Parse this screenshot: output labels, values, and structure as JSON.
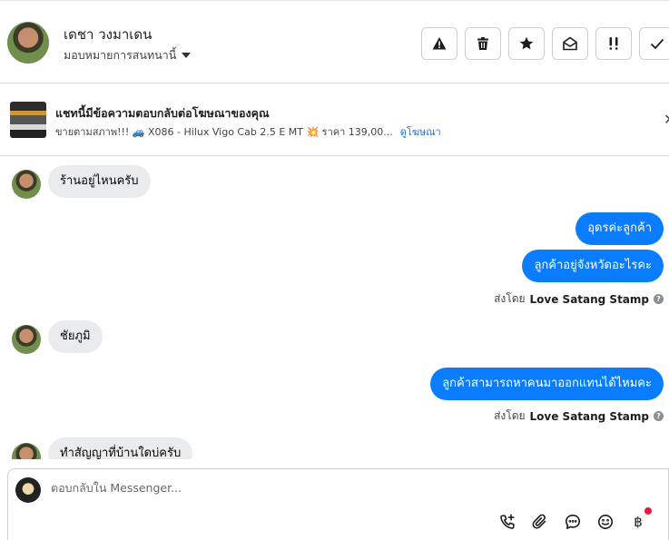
{
  "header": {
    "contact_name": "เดชา วงมาเดน",
    "assign_label": "มอบหมายการสนทนานี้",
    "actions": [
      {
        "name": "report-spam",
        "icon": "warning-icon"
      },
      {
        "name": "delete",
        "icon": "trash-icon"
      },
      {
        "name": "star",
        "icon": "star-icon"
      },
      {
        "name": "mark-unread",
        "icon": "envelope-open-icon"
      },
      {
        "name": "follow-up",
        "icon": "double-exclamation-icon"
      },
      {
        "name": "mark-done",
        "icon": "check-icon"
      }
    ]
  },
  "ad": {
    "title": "แชทนี้มีข้อความตอบกลับต่อโฆษณาของคุณ",
    "description": "ขายตามสภาพ!!! 🚙 X086 - Hilux Vigo Cab 2.5 E MT 💥 ราคา 139,00...",
    "link_label": "ดูโฆษณา"
  },
  "messages": [
    {
      "dir": "in",
      "text": "ร้านอยู่ไหนครับ"
    },
    {
      "dir": "out",
      "text": "อุดรค่ะลูกค้า"
    },
    {
      "dir": "out",
      "text": "ลูกค้าอยู่จังหวัดอะไรคะ"
    },
    {
      "type": "sent_by",
      "prefix": "ส่งโดย",
      "sender": "Love Satang Stamp"
    },
    {
      "dir": "in",
      "text": "ชัยภูมิ"
    },
    {
      "dir": "out",
      "text": "ลูกค้าสามารถหาคนมาออกแทนได้ไหมคะ"
    },
    {
      "type": "sent_by",
      "prefix": "ส่งโดย",
      "sender": "Love Satang Stamp"
    },
    {
      "dir": "in",
      "text": "ทำสัญญาที่บ้านใดบ่ครับ"
    }
  ],
  "composer": {
    "placeholder": "ตอบกลับใน Messenger...",
    "currency_symbol": "฿",
    "tools": [
      "call-add-icon",
      "paperclip-icon",
      "saved-replies-icon",
      "emoji-icon",
      "baht-icon"
    ]
  }
}
